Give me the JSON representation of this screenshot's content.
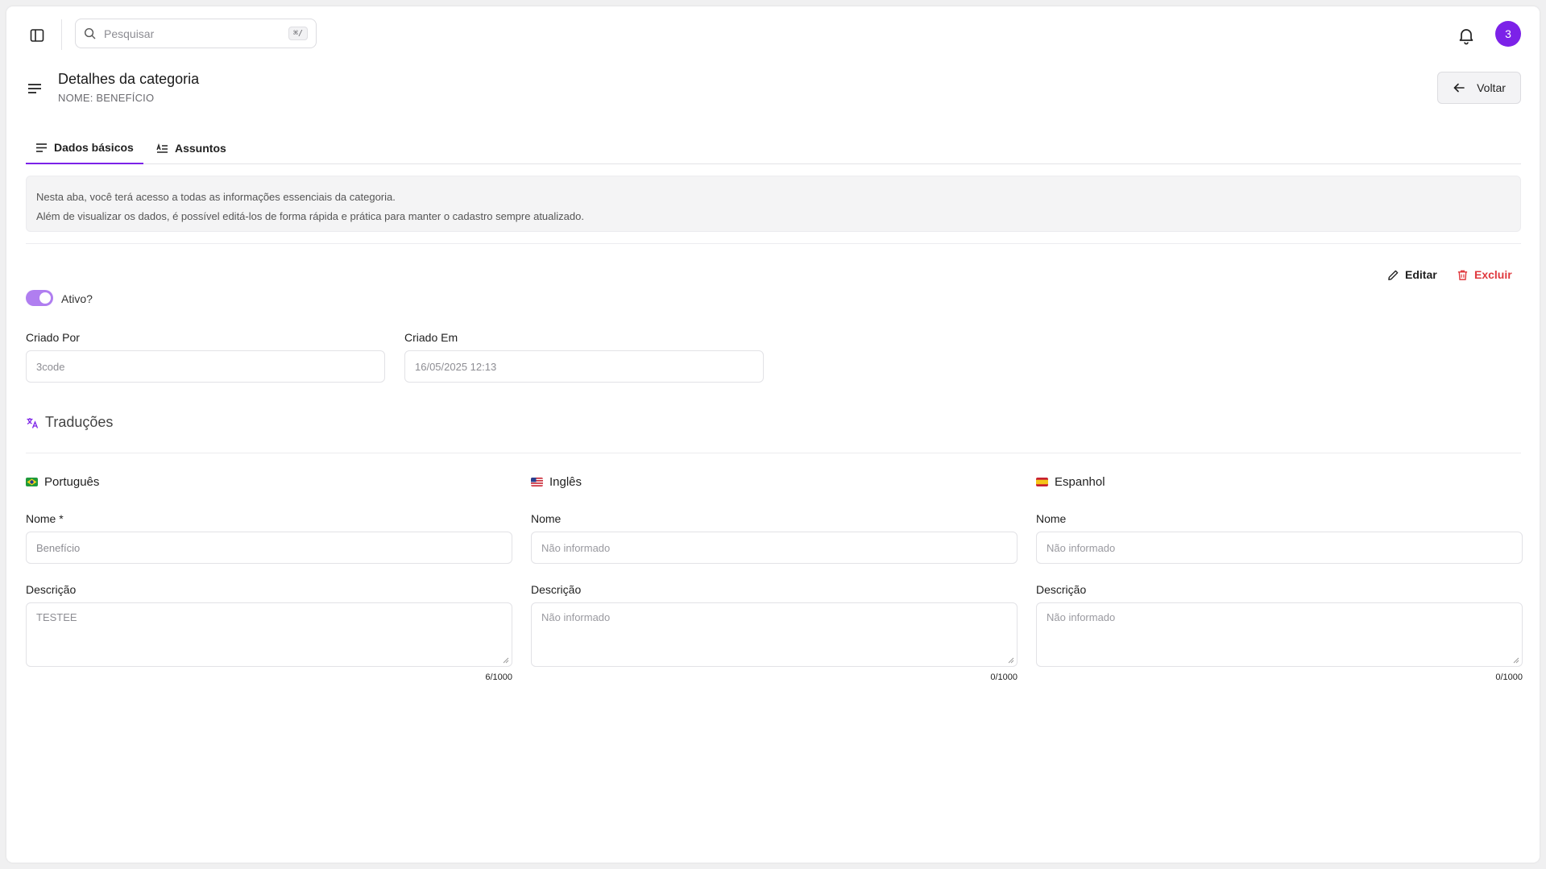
{
  "topbar": {
    "search_placeholder": "Pesquisar",
    "search_shortcut": "⌘/",
    "avatar_text": "3"
  },
  "header": {
    "title": "Detalhes da categoria",
    "subtitle": "NOME: BENEFÍCIO",
    "back_label": "Voltar"
  },
  "tabs": [
    {
      "label": "Dados básicos",
      "active": true
    },
    {
      "label": "Assuntos",
      "active": false
    }
  ],
  "info": {
    "line1": "Nesta aba, você terá acesso a todas as informações essenciais da categoria.",
    "line2": "Além de visualizar os dados, é possível editá-los de forma rápida e prática para manter o cadastro sempre atualizado."
  },
  "actions": {
    "edit_label": "Editar",
    "delete_label": "Excluir"
  },
  "status": {
    "toggle_label": "Ativo?",
    "active": true
  },
  "meta": {
    "created_by_label": "Criado Por",
    "created_by_value": "3code",
    "created_at_label": "Criado Em",
    "created_at_value": "16/05/2025 12:13"
  },
  "translations": {
    "title": "Traduções",
    "languages": [
      {
        "name": "Português",
        "name_label": "Nome *",
        "name_value": "Benefício",
        "desc_label": "Descrição",
        "desc_value": "TESTEE",
        "counter": "6/1000"
      },
      {
        "name": "Inglês",
        "name_label": "Nome",
        "name_value": "Não informado",
        "desc_label": "Descrição",
        "desc_value": "Não informado",
        "counter": "0/1000"
      },
      {
        "name": "Espanhol",
        "name_label": "Nome",
        "name_value": "Não informado",
        "desc_label": "Descrição",
        "desc_value": "Não informado",
        "counter": "0/1000"
      }
    ]
  },
  "colors": {
    "accent": "#7c22e8",
    "toggle": "#b07ef0",
    "danger": "#e0393e"
  }
}
